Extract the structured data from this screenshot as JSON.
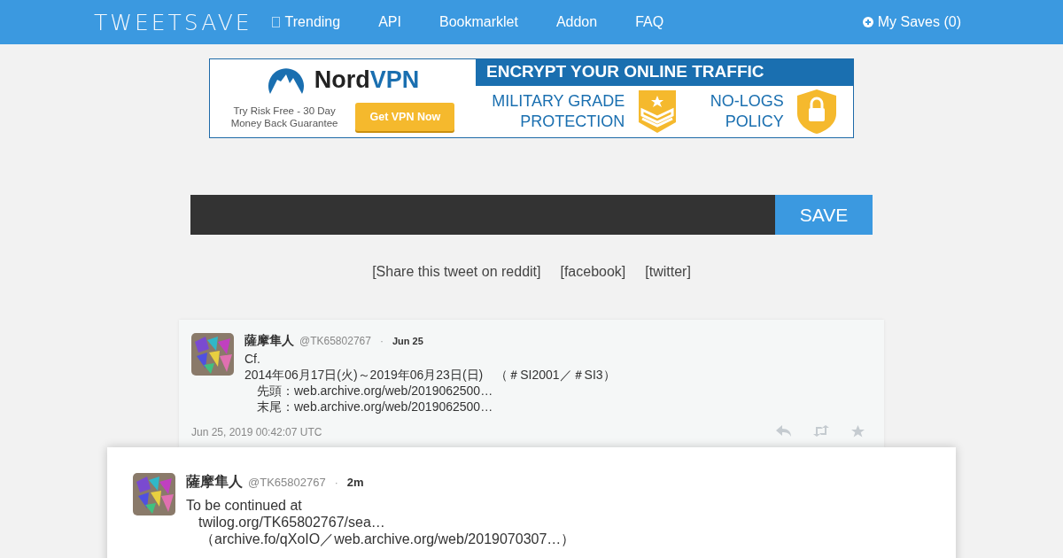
{
  "header": {
    "logo": "TWEETSAVE",
    "nav": [
      {
        "label": "Trending",
        "icon": true
      },
      {
        "label": "API",
        "icon": false
      },
      {
        "label": "Bookmarklet",
        "icon": false
      },
      {
        "label": "Addon",
        "icon": false
      },
      {
        "label": "FAQ",
        "icon": false
      }
    ],
    "my_saves": "My Saves (0)"
  },
  "ad": {
    "brand": "Nord",
    "brand_accent": "VPN",
    "tagline": [
      "Try Risk Free - 30 Day",
      "Money Back Guarantee"
    ],
    "cta": "Get VPN Now",
    "headline": "ENCRYPT YOUR ONLINE TRAFFIC",
    "features": [
      {
        "kind": "badge",
        "lines": [
          "MILITARY GRADE",
          "PROTECTION"
        ]
      },
      {
        "kind": "lock",
        "lines": [
          "NO-LOGS",
          "POLICY"
        ]
      }
    ]
  },
  "search": {
    "button": "SAVE"
  },
  "share": [
    "[Share this tweet on reddit]",
    "[facebook]",
    "[twitter]"
  ],
  "tweets": [
    {
      "name": "薩摩隼人",
      "handle": "@TK65802767",
      "separator": "·",
      "time": "Jun 25",
      "lines": [
        {
          "kind": "plain",
          "text": "Cf."
        },
        {
          "kind": "plain",
          "text": "2014年06月17日(火)～2019年06月23日(日)　（＃SI2001／＃SI3）"
        },
        {
          "kind": "indent",
          "text": "先頭：web.archive.org/web/2019062500…"
        },
        {
          "kind": "indent",
          "text": "末尾：web.archive.org/web/2019062500…"
        }
      ],
      "footer": "Jun 25, 2019 00:42:07 UTC",
      "featured": false
    },
    {
      "name": "薩摩隼人",
      "handle": "@TK65802767",
      "separator": "·",
      "time": "2m",
      "lines": [
        {
          "kind": "plain",
          "text": "To be continued at"
        },
        {
          "kind": "indent",
          "text": "twilog.org/TK65802767/sea…"
        },
        {
          "kind": "indent2",
          "text": "（archive.fo/qXoIO／web.archive.org/web/2019070307…）"
        }
      ],
      "featured": true
    }
  ]
}
